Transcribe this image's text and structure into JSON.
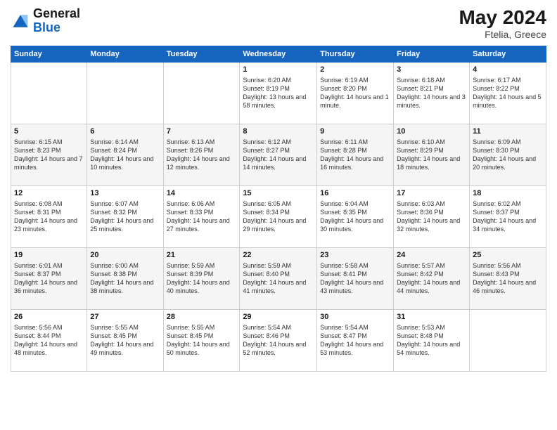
{
  "logo": {
    "line1": "General",
    "line2": "Blue"
  },
  "title": "May 2024",
  "subtitle": "Ftelia, Greece",
  "weekdays": [
    "Sunday",
    "Monday",
    "Tuesday",
    "Wednesday",
    "Thursday",
    "Friday",
    "Saturday"
  ],
  "weeks": [
    [
      {
        "day": "",
        "sunrise": "",
        "sunset": "",
        "daylight": ""
      },
      {
        "day": "",
        "sunrise": "",
        "sunset": "",
        "daylight": ""
      },
      {
        "day": "",
        "sunrise": "",
        "sunset": "",
        "daylight": ""
      },
      {
        "day": "1",
        "sunrise": "Sunrise: 6:20 AM",
        "sunset": "Sunset: 8:19 PM",
        "daylight": "Daylight: 13 hours and 58 minutes."
      },
      {
        "day": "2",
        "sunrise": "Sunrise: 6:19 AM",
        "sunset": "Sunset: 8:20 PM",
        "daylight": "Daylight: 14 hours and 1 minute."
      },
      {
        "day": "3",
        "sunrise": "Sunrise: 6:18 AM",
        "sunset": "Sunset: 8:21 PM",
        "daylight": "Daylight: 14 hours and 3 minutes."
      },
      {
        "day": "4",
        "sunrise": "Sunrise: 6:17 AM",
        "sunset": "Sunset: 8:22 PM",
        "daylight": "Daylight: 14 hours and 5 minutes."
      }
    ],
    [
      {
        "day": "5",
        "sunrise": "Sunrise: 6:15 AM",
        "sunset": "Sunset: 8:23 PM",
        "daylight": "Daylight: 14 hours and 7 minutes."
      },
      {
        "day": "6",
        "sunrise": "Sunrise: 6:14 AM",
        "sunset": "Sunset: 8:24 PM",
        "daylight": "Daylight: 14 hours and 10 minutes."
      },
      {
        "day": "7",
        "sunrise": "Sunrise: 6:13 AM",
        "sunset": "Sunset: 8:26 PM",
        "daylight": "Daylight: 14 hours and 12 minutes."
      },
      {
        "day": "8",
        "sunrise": "Sunrise: 6:12 AM",
        "sunset": "Sunset: 8:27 PM",
        "daylight": "Daylight: 14 hours and 14 minutes."
      },
      {
        "day": "9",
        "sunrise": "Sunrise: 6:11 AM",
        "sunset": "Sunset: 8:28 PM",
        "daylight": "Daylight: 14 hours and 16 minutes."
      },
      {
        "day": "10",
        "sunrise": "Sunrise: 6:10 AM",
        "sunset": "Sunset: 8:29 PM",
        "daylight": "Daylight: 14 hours and 18 minutes."
      },
      {
        "day": "11",
        "sunrise": "Sunrise: 6:09 AM",
        "sunset": "Sunset: 8:30 PM",
        "daylight": "Daylight: 14 hours and 20 minutes."
      }
    ],
    [
      {
        "day": "12",
        "sunrise": "Sunrise: 6:08 AM",
        "sunset": "Sunset: 8:31 PM",
        "daylight": "Daylight: 14 hours and 23 minutes."
      },
      {
        "day": "13",
        "sunrise": "Sunrise: 6:07 AM",
        "sunset": "Sunset: 8:32 PM",
        "daylight": "Daylight: 14 hours and 25 minutes."
      },
      {
        "day": "14",
        "sunrise": "Sunrise: 6:06 AM",
        "sunset": "Sunset: 8:33 PM",
        "daylight": "Daylight: 14 hours and 27 minutes."
      },
      {
        "day": "15",
        "sunrise": "Sunrise: 6:05 AM",
        "sunset": "Sunset: 8:34 PM",
        "daylight": "Daylight: 14 hours and 29 minutes."
      },
      {
        "day": "16",
        "sunrise": "Sunrise: 6:04 AM",
        "sunset": "Sunset: 8:35 PM",
        "daylight": "Daylight: 14 hours and 30 minutes."
      },
      {
        "day": "17",
        "sunrise": "Sunrise: 6:03 AM",
        "sunset": "Sunset: 8:36 PM",
        "daylight": "Daylight: 14 hours and 32 minutes."
      },
      {
        "day": "18",
        "sunrise": "Sunrise: 6:02 AM",
        "sunset": "Sunset: 8:37 PM",
        "daylight": "Daylight: 14 hours and 34 minutes."
      }
    ],
    [
      {
        "day": "19",
        "sunrise": "Sunrise: 6:01 AM",
        "sunset": "Sunset: 8:37 PM",
        "daylight": "Daylight: 14 hours and 36 minutes."
      },
      {
        "day": "20",
        "sunrise": "Sunrise: 6:00 AM",
        "sunset": "Sunset: 8:38 PM",
        "daylight": "Daylight: 14 hours and 38 minutes."
      },
      {
        "day": "21",
        "sunrise": "Sunrise: 5:59 AM",
        "sunset": "Sunset: 8:39 PM",
        "daylight": "Daylight: 14 hours and 40 minutes."
      },
      {
        "day": "22",
        "sunrise": "Sunrise: 5:59 AM",
        "sunset": "Sunset: 8:40 PM",
        "daylight": "Daylight: 14 hours and 41 minutes."
      },
      {
        "day": "23",
        "sunrise": "Sunrise: 5:58 AM",
        "sunset": "Sunset: 8:41 PM",
        "daylight": "Daylight: 14 hours and 43 minutes."
      },
      {
        "day": "24",
        "sunrise": "Sunrise: 5:57 AM",
        "sunset": "Sunset: 8:42 PM",
        "daylight": "Daylight: 14 hours and 44 minutes."
      },
      {
        "day": "25",
        "sunrise": "Sunrise: 5:56 AM",
        "sunset": "Sunset: 8:43 PM",
        "daylight": "Daylight: 14 hours and 46 minutes."
      }
    ],
    [
      {
        "day": "26",
        "sunrise": "Sunrise: 5:56 AM",
        "sunset": "Sunset: 8:44 PM",
        "daylight": "Daylight: 14 hours and 48 minutes."
      },
      {
        "day": "27",
        "sunrise": "Sunrise: 5:55 AM",
        "sunset": "Sunset: 8:45 PM",
        "daylight": "Daylight: 14 hours and 49 minutes."
      },
      {
        "day": "28",
        "sunrise": "Sunrise: 5:55 AM",
        "sunset": "Sunset: 8:45 PM",
        "daylight": "Daylight: 14 hours and 50 minutes."
      },
      {
        "day": "29",
        "sunrise": "Sunrise: 5:54 AM",
        "sunset": "Sunset: 8:46 PM",
        "daylight": "Daylight: 14 hours and 52 minutes."
      },
      {
        "day": "30",
        "sunrise": "Sunrise: 5:54 AM",
        "sunset": "Sunset: 8:47 PM",
        "daylight": "Daylight: 14 hours and 53 minutes."
      },
      {
        "day": "31",
        "sunrise": "Sunrise: 5:53 AM",
        "sunset": "Sunset: 8:48 PM",
        "daylight": "Daylight: 14 hours and 54 minutes."
      },
      {
        "day": "",
        "sunrise": "",
        "sunset": "",
        "daylight": ""
      }
    ]
  ]
}
